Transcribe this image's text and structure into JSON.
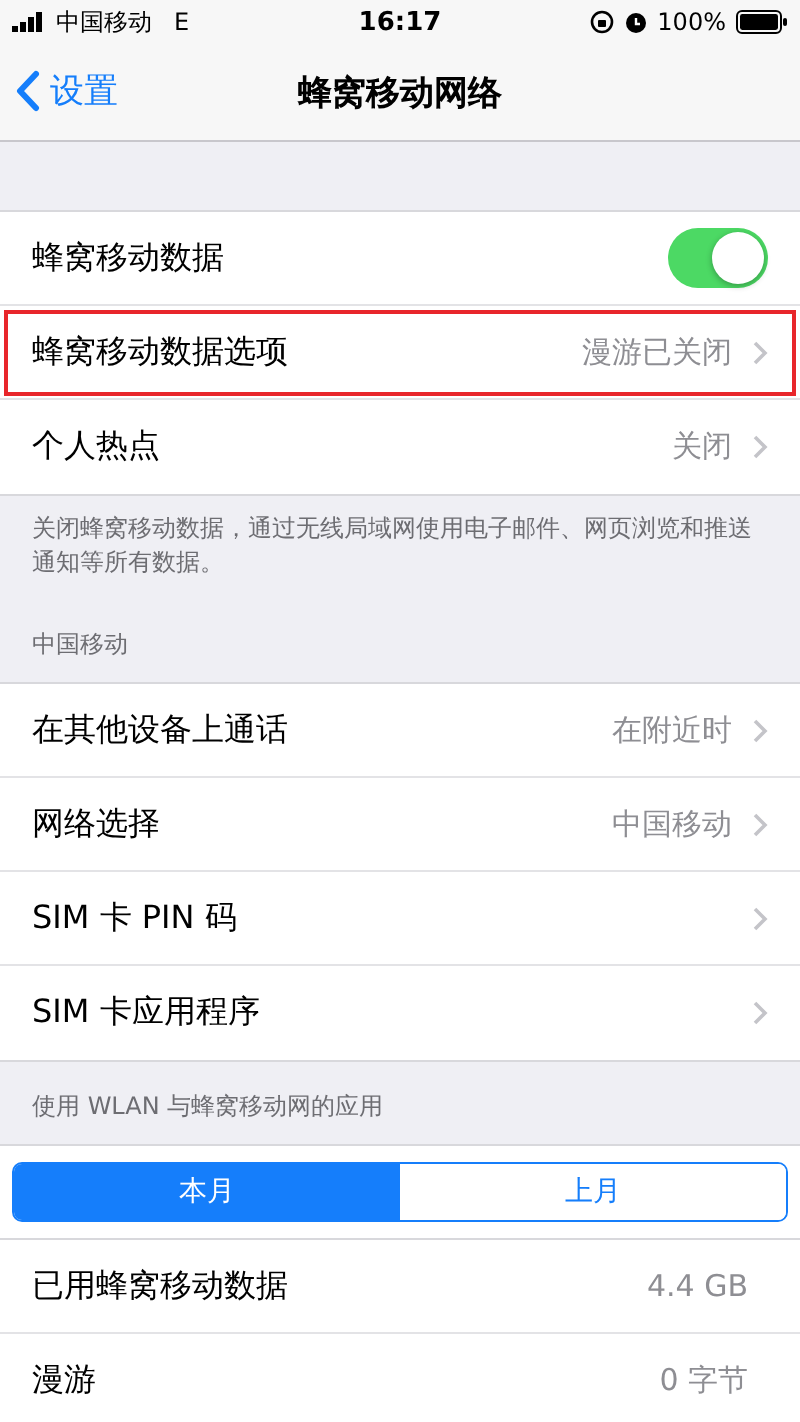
{
  "status_bar": {
    "carrier": "中国移动",
    "network": "E",
    "time": "16:17",
    "battery": "100%"
  },
  "nav": {
    "back": "设置",
    "title": "蜂窝移动网络"
  },
  "sections": [
    {
      "rows": [
        {
          "kind": "toggle",
          "label": "蜂窝移动数据",
          "on": true,
          "highlighted": false
        },
        {
          "kind": "link",
          "label": "蜂窝移动数据选项",
          "value": "漫游已关闭",
          "highlighted": true
        },
        {
          "kind": "link",
          "label": "个人热点",
          "value": "关闭",
          "highlighted": false
        }
      ],
      "footer": "关闭蜂窝移动数据，通过无线局域网使用电子邮件、网页浏览和推送通知等所有数据。"
    },
    {
      "header": "中国移动",
      "rows": [
        {
          "kind": "link",
          "label": "在其他设备上通话",
          "value": "在附近时",
          "highlighted": false
        },
        {
          "kind": "link",
          "label": "网络选择",
          "value": "中国移动",
          "highlighted": false
        },
        {
          "kind": "link",
          "label": "SIM 卡 PIN 码",
          "highlighted": false
        },
        {
          "kind": "link",
          "label": "SIM 卡应用程序",
          "highlighted": false
        }
      ]
    },
    {
      "header": "使用 WLAN 与蜂窝移动网的应用",
      "segments": [
        {
          "label": "本月",
          "selected": true
        },
        {
          "label": "上月",
          "selected": false
        }
      ],
      "rows": [
        {
          "kind": "value",
          "label": "已用蜂窝移动数据",
          "value": "4.4 GB",
          "highlighted": false
        },
        {
          "kind": "value",
          "label": "漫游",
          "value": "0 字节",
          "highlighted": false
        }
      ]
    }
  ]
}
